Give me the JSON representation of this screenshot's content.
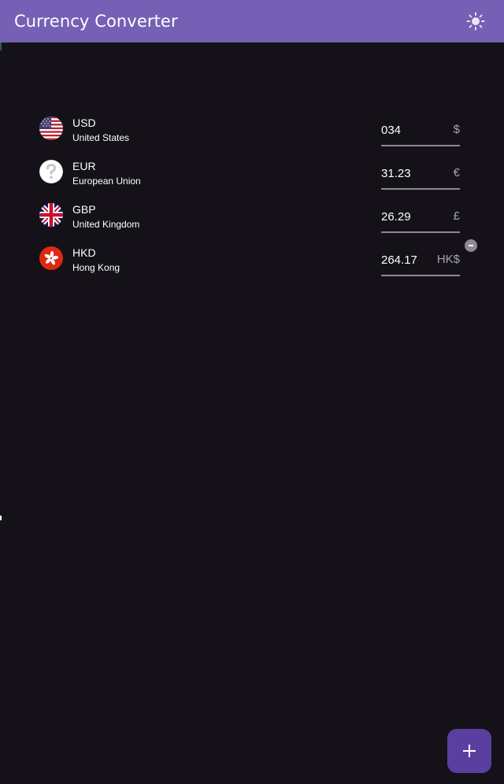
{
  "appbar": {
    "title": "Currency Converter",
    "theme_icon": "sun-icon"
  },
  "currencies": [
    {
      "code": "USD",
      "country": "United States",
      "amount": "034",
      "symbol": "$",
      "flag": "us-flag-icon"
    },
    {
      "code": "EUR",
      "country": "European Union",
      "amount": "31.23",
      "symbol": "€",
      "flag": "unknown-flag-icon"
    },
    {
      "code": "GBP",
      "country": "United Kingdom",
      "amount": "26.29",
      "symbol": "£",
      "flag": "uk-flag-icon"
    },
    {
      "code": "HKD",
      "country": "Hong Kong",
      "amount": "264.17",
      "symbol": "HK$",
      "flag": "hk-flag-icon"
    }
  ],
  "fab": {
    "icon": "plus-icon"
  },
  "colors": {
    "appbar": "#7560b5",
    "background": "#141218",
    "fab": "#5a3fa0"
  }
}
